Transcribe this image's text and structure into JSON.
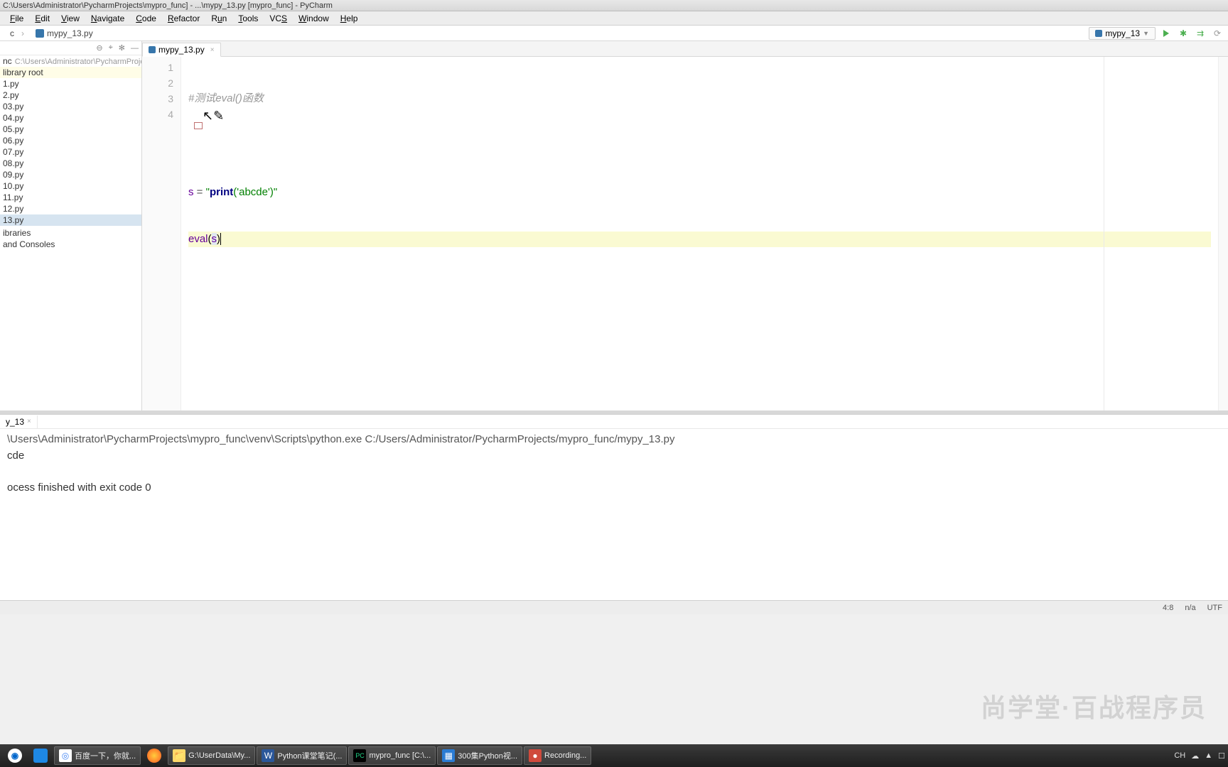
{
  "window": {
    "title": "C:\\Users\\Administrator\\PycharmProjects\\mypro_func] - ...\\mypy_13.py [mypro_func] - PyCharm"
  },
  "menu": {
    "items": [
      "File",
      "Edit",
      "View",
      "Navigate",
      "Code",
      "Refactor",
      "Run",
      "Tools",
      "VCS",
      "Window",
      "Help"
    ]
  },
  "breadcrumb": {
    "items": [
      "c",
      "mypy_13.py"
    ]
  },
  "run_config": {
    "name": "mypy_13"
  },
  "sidebar": {
    "project_line": "nc",
    "project_path": "C:\\Users\\Administrator\\PycharmProject",
    "library_root": "library root",
    "files": [
      "1.py",
      "2.py",
      "03.py",
      "04.py",
      "05.py",
      "06.py",
      "07.py",
      "08.py",
      "09.py",
      "10.py",
      "11.py",
      "12.py",
      "13.py"
    ],
    "extra_items": [
      "",
      "ibraries",
      "and Consoles"
    ]
  },
  "editor": {
    "tab_name": "mypy_13.py",
    "lines": {
      "1": {
        "comment": "#测试eval()函数"
      },
      "2": {},
      "3": {
        "var": "s",
        "op": " = ",
        "str_open": "\"",
        "call": "print",
        "str_rest": "('abcde')\""
      },
      "4": {
        "builtin": "eval",
        "paren_open": "(",
        "arg": "s",
        "paren_close": ")"
      }
    },
    "line_numbers": [
      "1",
      "2",
      "3",
      "4"
    ]
  },
  "console": {
    "tab_label": "y_13",
    "cmd_line": "\\Users\\Administrator\\PycharmProjects\\mypro_func\\venv\\Scripts\\python.exe C:/Users/Administrator/PycharmProjects/mypro_func/mypy_13.py",
    "output": "cde",
    "exit_line": "ocess finished with exit code 0"
  },
  "status": {
    "pos": "4:8",
    "na": "n/a",
    "enc": "UTF"
  },
  "taskbar": {
    "items": [
      {
        "name": "百度一下，你就...",
        "color": "#4285f4",
        "glyph": "◎"
      },
      {
        "name": "",
        "color": "#ff9500",
        "glyph": ""
      },
      {
        "name": "G:\\UserData\\My...",
        "color": "#ffd96a",
        "glyph": "📁"
      },
      {
        "name": "Python课堂笔记(...",
        "color": "#2b579a",
        "glyph": "W"
      },
      {
        "name": "mypro_func [C:\\...",
        "color": "#21d789",
        "glyph": "PC"
      },
      {
        "name": "300集Python视...",
        "color": "#2b7cd3",
        "glyph": "📄"
      },
      {
        "name": "Recording...",
        "color": "#d04a3c",
        "glyph": "●"
      }
    ],
    "tray": [
      "CH",
      "☁",
      "▲",
      "☐"
    ]
  },
  "watermark": "尚学堂·百战程序员"
}
